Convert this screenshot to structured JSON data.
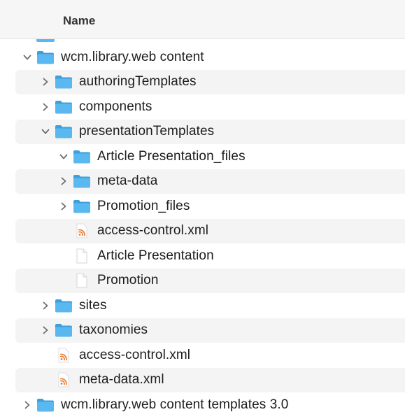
{
  "header": {
    "name_column": "Name"
  },
  "colors": {
    "folder_body": "#5ab8f0",
    "folder_tab": "#3d9fdc",
    "rss_orange": "#e8762b",
    "stripe": "#f4f4f5",
    "chevron": "#6e6e73"
  },
  "rows": [
    {
      "label": "wcm.library.web content",
      "icon": "folder-icon",
      "disclosure": "expanded",
      "level": 0
    },
    {
      "label": "authoringTemplates",
      "icon": "folder-icon",
      "disclosure": "collapsed",
      "level": 1
    },
    {
      "label": "components",
      "icon": "folder-icon",
      "disclosure": "collapsed",
      "level": 1
    },
    {
      "label": "presentationTemplates",
      "icon": "folder-icon",
      "disclosure": "expanded",
      "level": 1
    },
    {
      "label": "Article Presentation_files",
      "icon": "folder-icon",
      "disclosure": "expanded",
      "level": 2
    },
    {
      "label": "meta-data",
      "icon": "folder-icon",
      "disclosure": "collapsed",
      "level": 2
    },
    {
      "label": "Promotion_files",
      "icon": "folder-icon",
      "disclosure": "collapsed",
      "level": 2
    },
    {
      "label": "access-control.xml",
      "icon": "rss-xml-file-icon",
      "disclosure": "none",
      "level": 2
    },
    {
      "label": "Article Presentation",
      "icon": "blank-document-icon",
      "disclosure": "none",
      "level": 2
    },
    {
      "label": "Promotion",
      "icon": "blank-document-icon",
      "disclosure": "none",
      "level": 2
    },
    {
      "label": "sites",
      "icon": "folder-icon",
      "disclosure": "collapsed",
      "level": 1
    },
    {
      "label": "taxonomies",
      "icon": "folder-icon",
      "disclosure": "collapsed",
      "level": 1
    },
    {
      "label": "access-control.xml",
      "icon": "rss-xml-file-icon",
      "disclosure": "none",
      "level": 1
    },
    {
      "label": "meta-data.xml",
      "icon": "rss-xml-file-icon",
      "disclosure": "none",
      "level": 1
    },
    {
      "label": "wcm.library.web content templates 3.0",
      "icon": "folder-icon",
      "disclosure": "collapsed",
      "level": 0
    }
  ]
}
